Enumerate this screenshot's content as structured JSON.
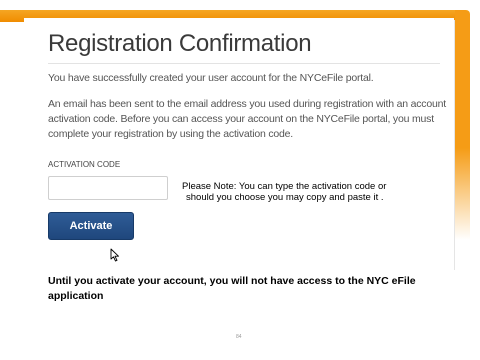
{
  "page": {
    "title": "Registration Confirmation",
    "success_message": "You have successfully created your user account for the NYCeFile portal.",
    "email_message": "An email has been sent to the email address you used during registration with an account activation code. Before you can access your account on the NYCeFile portal, you must complete your registration by using the activation code."
  },
  "form": {
    "activation_code_label": "ACTIVATION CODE",
    "activation_code_value": "",
    "activate_button_label": "Activate"
  },
  "annotations": {
    "note_line1": "Please Note: You can type the activation code or",
    "note_line2": "should you choose you may copy and paste it .",
    "warning": "Until you activate your account, you will not have access to the NYC eFile application"
  },
  "slide": {
    "page_number": "84"
  },
  "colors": {
    "accent_orange": "#f59c16",
    "button_blue": "#27528a"
  }
}
